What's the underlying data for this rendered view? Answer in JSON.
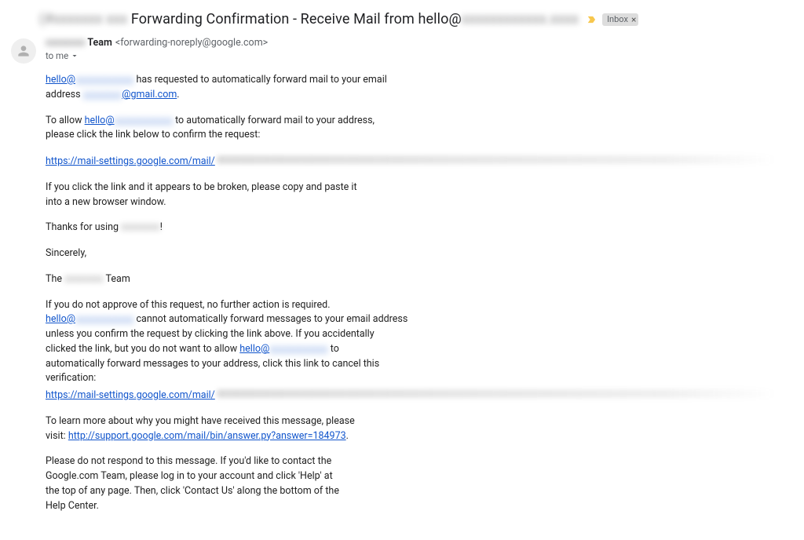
{
  "subject": {
    "prefix_hidden": "(#xxxxxxx xxx",
    "main": "Forwarding Confirmation - Receive Mail from hello@",
    "suffix_hidden": "xxxxxxxxxxxx.xxxx"
  },
  "label": {
    "name": "Inbox",
    "close_glyph": "×"
  },
  "sender": {
    "name_hidden": "xxxxxxxx",
    "name_visible": "Team",
    "address_open": "<",
    "address": "forwarding-noreply@google.com",
    "address_close": ">"
  },
  "recipient_line": "to me",
  "body": {
    "p1_a": "hello@",
    "p1_a_hidden": "xxxxxxxxxxxx",
    "p1_b": " has requested to automatically forward mail to your email",
    "p1_c": "address ",
    "p1_c_hidden": "xxxxxxxx",
    "p1_d": "@gmail.com",
    "p1_e": ".",
    "p2_a": "To allow ",
    "p2_b": "hello@",
    "p2_b_hidden": "xxxxxxxxxxxx",
    "p2_c": " to automatically forward mail to your address,",
    "p2_d": "please click the link below to confirm the request:",
    "confirm_link": "https://mail-settings.google.com/mail/",
    "p3_a": "If you click the link and it appears to be broken, please copy and paste it",
    "p3_b": "into a new browser window.",
    "p4_a": "Thanks for using ",
    "p4_a_hidden": "xxxxxxxx",
    "p4_b": "!",
    "p5": "Sincerely,",
    "p6_a": "The ",
    "p6_a_hidden": "xxxxxxxx",
    "p6_b": " Team",
    "p7_a": "If you do not approve of this request, no further action is required.",
    "p7_b": "hello@",
    "p7_b_hidden": "xxxxxxxxxxxx",
    "p7_c": " cannot automatically forward messages to your email address",
    "p7_d": "unless you confirm the request by clicking the link above. If you accidentally",
    "p7_e": "clicked the link, but you do not want to allow ",
    "p7_f": "hello@",
    "p7_f_hidden": "xxxxxxxxxxxx",
    "p7_g": " to",
    "p7_h": "automatically forward messages to your address, click this link to cancel this",
    "p7_i": "verification:",
    "cancel_link": "https://mail-settings.google.com/mail/",
    "p8_a": "To learn more about why you might have received this message, please",
    "p8_b": "visit: ",
    "support_link": "http://support.google.com/mail/bin/answer.py?answer=184973",
    "p8_c": ".",
    "p9_a": "Please do not respond to this message. If you'd like to contact the",
    "p9_b": "Google.com Team, please log in to your account and click 'Help' at",
    "p9_c": "the top of any page. Then, click 'Contact Us' along the bottom of the",
    "p9_d": "Help Center."
  }
}
